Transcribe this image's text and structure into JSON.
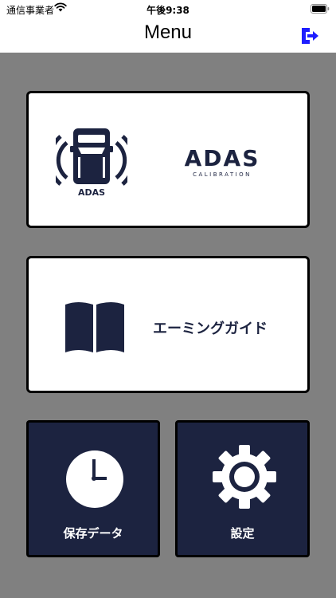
{
  "status_bar": {
    "carrier": "通信事業者",
    "time": "午後9:38"
  },
  "nav": {
    "title": "Menu"
  },
  "menu": {
    "adas": {
      "icon_label": "ADAS",
      "logo": "ADAS",
      "logo_sub": "CALIBRATION"
    },
    "aiming_guide": {
      "label": "エーミングガイド"
    },
    "saved_data": {
      "label": "保存データ"
    },
    "settings": {
      "label": "設定"
    }
  },
  "colors": {
    "navy": "#1c2340",
    "background": "#808080",
    "logout_icon": "#1e1eff"
  },
  "icons": {
    "logout": "logout-icon",
    "car": "adas-car-icon",
    "book": "book-icon",
    "clock": "clock-icon",
    "gear": "gear-icon"
  }
}
